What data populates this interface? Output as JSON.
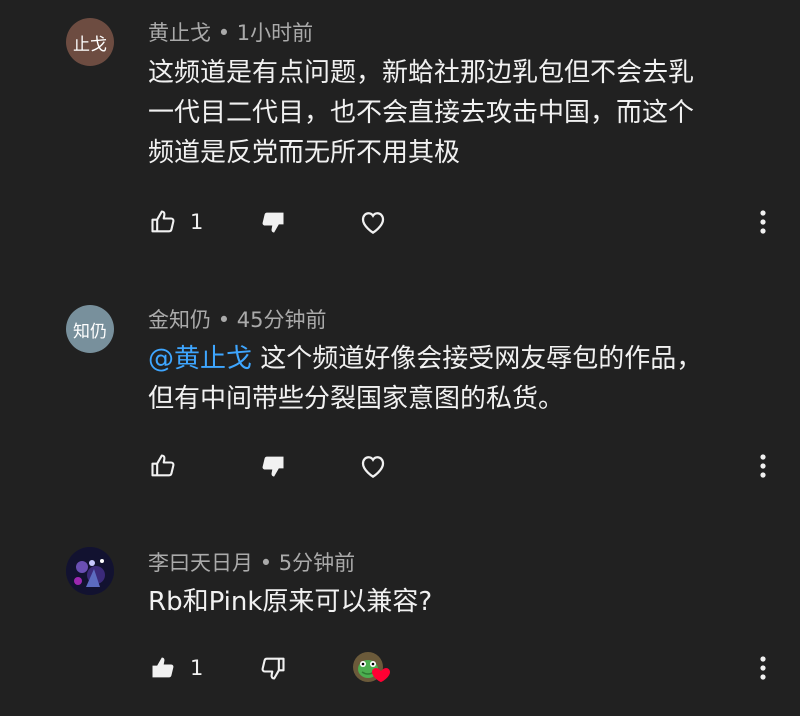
{
  "comments": [
    {
      "avatar_text": "止戈",
      "avatar_color": "#6d4c41",
      "author": "黄止戈",
      "separator": "•",
      "time": "1小时前",
      "lines": [
        "这频道是有点问题，新蛤社那边乳包但不会去乳",
        "一代目二代目，也不会直接去攻击中国，而这个",
        "频道是反党而无所不用其极"
      ],
      "like_count": "1"
    },
    {
      "avatar_text": "知仍",
      "avatar_color": "#78909c",
      "author": "金知仍",
      "separator": "•",
      "time": "45分钟前",
      "mention": "@黄止戈",
      "lines": [
        " 这个频道好像会接受网友辱包的作品，",
        "但有中间带些分裂国家意图的私货。"
      ],
      "like_count": ""
    },
    {
      "avatar_text": "",
      "avatar_color": "#1a1a3a",
      "author": "李曰天日月",
      "separator": "•",
      "time": "5分钟前",
      "lines": [
        "Rb和Pink原来可以兼容?"
      ],
      "like_count": "1"
    }
  ],
  "colors": {
    "background": "#212121",
    "mention": "#3ea6ff",
    "meta": "#aaaaaa",
    "heart": "#ff0033"
  },
  "icons": {
    "like": "thumb-up-icon",
    "dislike": "thumb-down-icon",
    "heart": "heart-icon",
    "more": "more-vertical-icon"
  }
}
